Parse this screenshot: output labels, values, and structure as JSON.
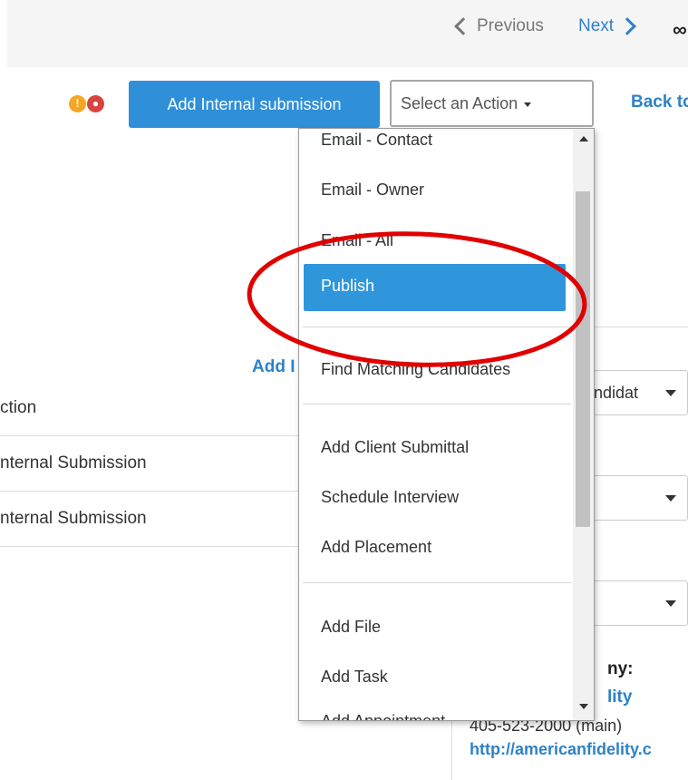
{
  "nav": {
    "previous_label": "Previous",
    "next_label": "Next"
  },
  "toolbar": {
    "add_internal_label": "Add Internal submission",
    "select_action_label": "Select an Action",
    "back_label": "Back to"
  },
  "table": {
    "add_partial": "Add I",
    "header": "ction",
    "rows": [
      "nternal Submission",
      "nternal Submission"
    ]
  },
  "actions_menu": {
    "items": [
      "Email - Contact",
      "Email - Owner",
      "Email - All",
      "Publish",
      "Find Matching Candidates",
      "Add Client Submittal",
      "Schedule Interview",
      "Add Placement",
      "Add File",
      "Add Task",
      "Add Appointment"
    ],
    "selected": "Publish"
  },
  "right_panel": {
    "select1": "ndidat",
    "company_label": "ny:",
    "company_name": "lity",
    "phone": "405-523-2000",
    "phone_type": "(main)",
    "website": "http://americanfidelity.c"
  },
  "colors": {
    "accent": "#2f8fd9",
    "link": "#2d82c8",
    "selected_item": "#2f96dc",
    "annotation_oval": "#e00000"
  }
}
